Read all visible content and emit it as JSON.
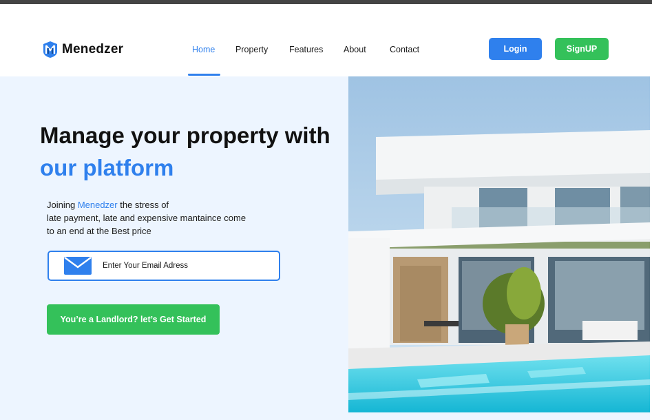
{
  "header": {
    "brand": "Menedzer",
    "nav": [
      {
        "label": "Home",
        "active": true
      },
      {
        "label": "Property",
        "active": false
      },
      {
        "label": "Features",
        "active": false
      },
      {
        "label": "About",
        "active": false
      },
      {
        "label": "Contact",
        "active": false
      }
    ],
    "login_label": "Login",
    "signup_label": "SignUP"
  },
  "hero": {
    "title_line1": "Manage your property with",
    "title_line2": "our platform",
    "desc_prefix": "Joining ",
    "desc_brand": "Menedzer",
    "desc_line1_rest": " the stress of",
    "desc_line2": "late payment, late and expensive mantaince come",
    "desc_line3": "to an end at the Best price",
    "email_placeholder": "Enter Your Email Adress",
    "cta_label": "You’re a Landlord? let’s Get  Started",
    "image": "modern-white-villa-with-pool"
  },
  "colors": {
    "accent": "#2f80ed",
    "success": "#34c15a",
    "hero_bg": "#edf5ff"
  },
  "icons": [
    "menedzer-logo-icon",
    "mail-icon"
  ]
}
